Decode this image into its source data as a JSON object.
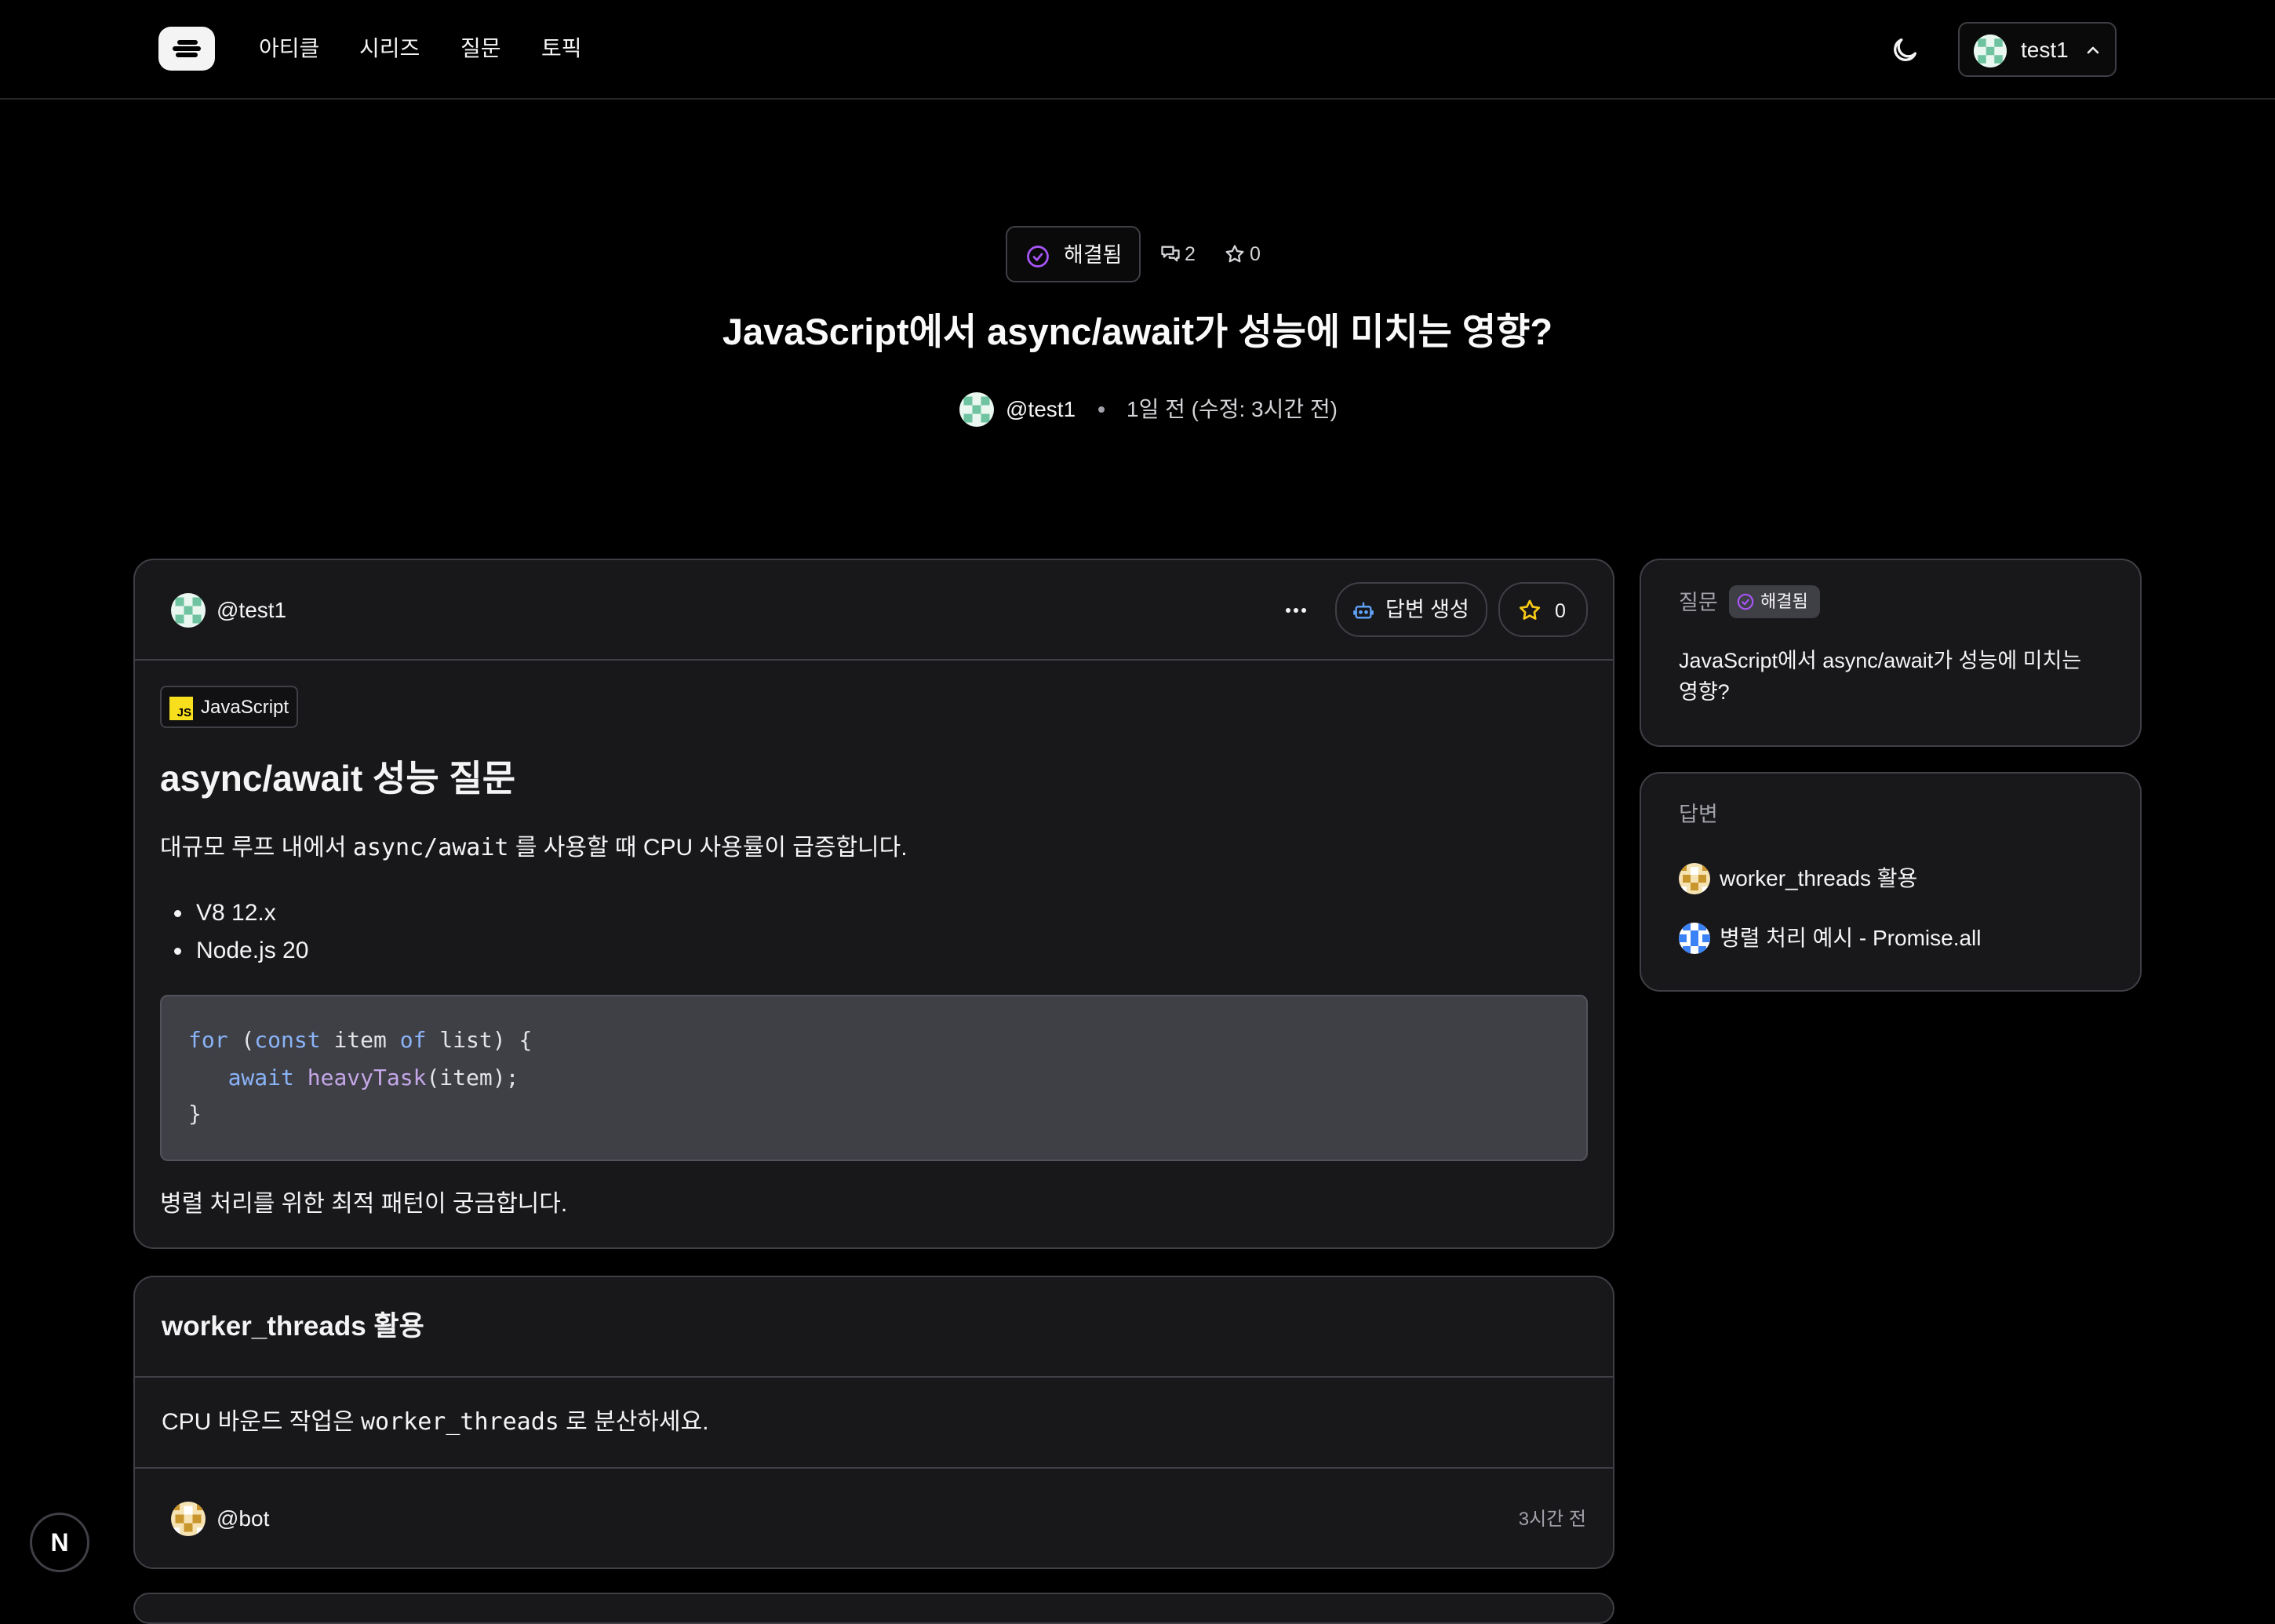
{
  "nav": {
    "logo_icon": "menu-logo-icon",
    "links": [
      "아티클",
      "시리즈",
      "질문",
      "토픽"
    ],
    "theme_icon": "moon-icon",
    "user": {
      "name": "test1",
      "chevron_icon": "chevron-up-icon"
    }
  },
  "question": {
    "status": "해결됨",
    "status_color": "#a855f7",
    "comment_count": "2",
    "star_count": "0",
    "title": "JavaScript에서 async/await가 성능에 미치는 영향?",
    "author": "@test1",
    "time": "1일 전 (수정: 3시간 전)"
  },
  "post": {
    "author": "@test1",
    "more_icon": "more-horizontal-icon",
    "generate_label": "답변 생성",
    "star_count": "0",
    "tag": "JavaScript",
    "heading": "async/await 성능 질문",
    "intro_before": "대규모 루프 내에서 ",
    "intro_code": "async/await",
    "intro_after": " 를 사용할 때 CPU 사용률이 급증합니다.",
    "bullets": [
      "V8 12.x",
      "Node.js 20"
    ],
    "code": {
      "l1_kw": "for",
      "l1_mid": " (",
      "l1_kw2": "const",
      "l1_rest1": " item ",
      "l1_kw3": "of",
      "l1_rest2": " list) {",
      "l2_indent": "   ",
      "l2_kw": "await",
      "l2_fn": " heavyTask",
      "l2_rest": "(item);",
      "l3": "}"
    },
    "closing": "병렬 처리를 위한 최적 패턴이 궁금합니다."
  },
  "answer": {
    "title": "worker_threads 활용",
    "body_before": "CPU 바운드 작업은 ",
    "body_code": "worker_threads",
    "body_after": " 로 분산하세요.",
    "author": "@bot",
    "time": "3시간 전"
  },
  "sidebar": {
    "question_label": "질문",
    "status": "해결됨",
    "question_title_line1": "JavaScript에서 async/await가 성능에 미치는",
    "question_title_line2": "영향?",
    "answers_label": "답변",
    "answers": [
      "worker_threads 활용",
      "병렬 처리 예시 - Promise.all"
    ]
  },
  "dev_badge": "N"
}
